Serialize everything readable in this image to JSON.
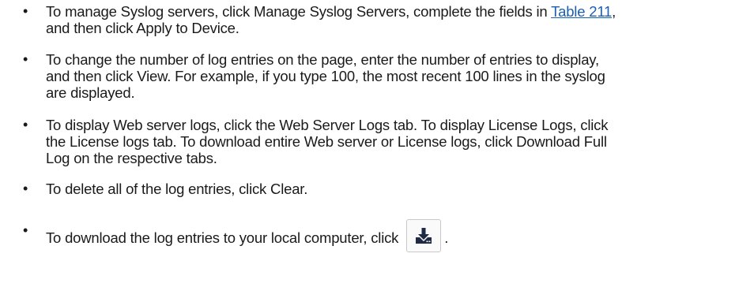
{
  "bullets": [
    {
      "glyph": "•",
      "line1_pre": "To manage Syslog servers, click Manage Syslog Servers, complete the fields in ",
      "link": "Table 211",
      "line1_post": ",",
      "line2": "and then click Apply to Device."
    },
    {
      "glyph": "•",
      "line1": "To change the number of log entries on the page, enter the number of entries to display,",
      "line2": "and then click View. For example, if you type 100, the most recent 100 lines in the syslog",
      "line3": "are displayed."
    },
    {
      "glyph": "•",
      "line1": "To display Web server logs, click the Web Server Logs tab. To display License Logs, click",
      "line2": "the License logs tab. To download entire Web server or License logs, click Download Full",
      "line3": "Log on the respective tabs."
    },
    {
      "glyph": "•",
      "line1": "To delete all of the log entries, click Clear."
    },
    {
      "glyph": "•",
      "line1": "To download the log entries to your local computer, click",
      "after_button": "."
    }
  ],
  "icons": {
    "download_button_icon": "download-icon",
    "icon_color": "#1f2a44"
  },
  "colors": {
    "link": "#1a5fb4",
    "text": "#1a1a1a"
  }
}
